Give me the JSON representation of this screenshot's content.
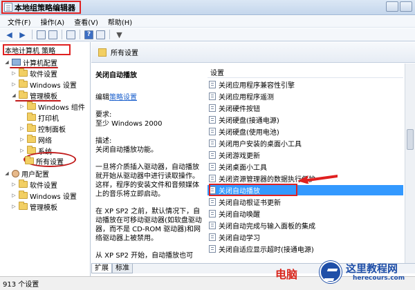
{
  "window": {
    "title": "本地组策略编辑器"
  },
  "menu": [
    "文件(F)",
    "操作(A)",
    "查看(V)",
    "帮助(H)"
  ],
  "tree": {
    "root": "本地计算机 策略",
    "computer_config": "计算机配置",
    "software_settings": "软件设置",
    "windows_settings": "Windows 设置",
    "admin_templates": "管理模板",
    "windows_components": "Windows 组件",
    "printers": "打印机",
    "control_panel": "控制面板",
    "network": "网络",
    "system": "系统",
    "all_settings": "所有设置",
    "user_config": "用户配置",
    "user_software_settings": "软件设置",
    "user_windows_settings": "Windows 设置",
    "user_admin_templates": "管理模板"
  },
  "header": {
    "title": "所有设置"
  },
  "description": {
    "title": "关闭自动播放",
    "edit_prefix": "编辑",
    "edit_link": "策略设置",
    "req_label": "要求:",
    "req_value": "至少 Windows 2000",
    "desc_label": "描述:",
    "desc_value": "关闭自动播放功能。",
    "para1": "一旦将介质插入驱动器，自动播放就开始从驱动器中进行读取操作。这样，程序的安装文件和音频媒体上的音乐将立即启动。",
    "para2": "在 XP SP2 之前，默认情况下，自动播放在可移动驱动器(如软盘驱动器，而不是 CD-ROM 驱动器)和网络驱动器上被禁用。",
    "para3": "从 XP SP2 开始，自动播放也可"
  },
  "list": {
    "header": "设置",
    "items": [
      "关闭应用程序兼容性引擎",
      "关闭应用程序遥测",
      "关闭硬件按钮",
      "关闭硬盘(接通电源)",
      "关闭硬盘(使用电池)",
      "关闭用户安装的桌面小工具",
      "关闭游戏更新",
      "关闭桌面小工具",
      "关闭资源管理器的数据执行保护",
      "关闭自动播放",
      "关闭自动根证书更新",
      "关闭自动唤醒",
      "关闭自动完成与输入面板的集成",
      "关闭自动学习",
      "关闭自适应显示超时(接通电源)"
    ],
    "selected_index": 9
  },
  "tabs": [
    "扩展",
    "标准"
  ],
  "status": {
    "text": "913 个设置"
  },
  "watermark": {
    "red_text": "电脑",
    "site_cn": "这里教程网",
    "site_en": "herecours.com"
  },
  "colors": {
    "selection": "#3399ff",
    "highlight_box": "#e02020",
    "annotation": "#c01818"
  }
}
